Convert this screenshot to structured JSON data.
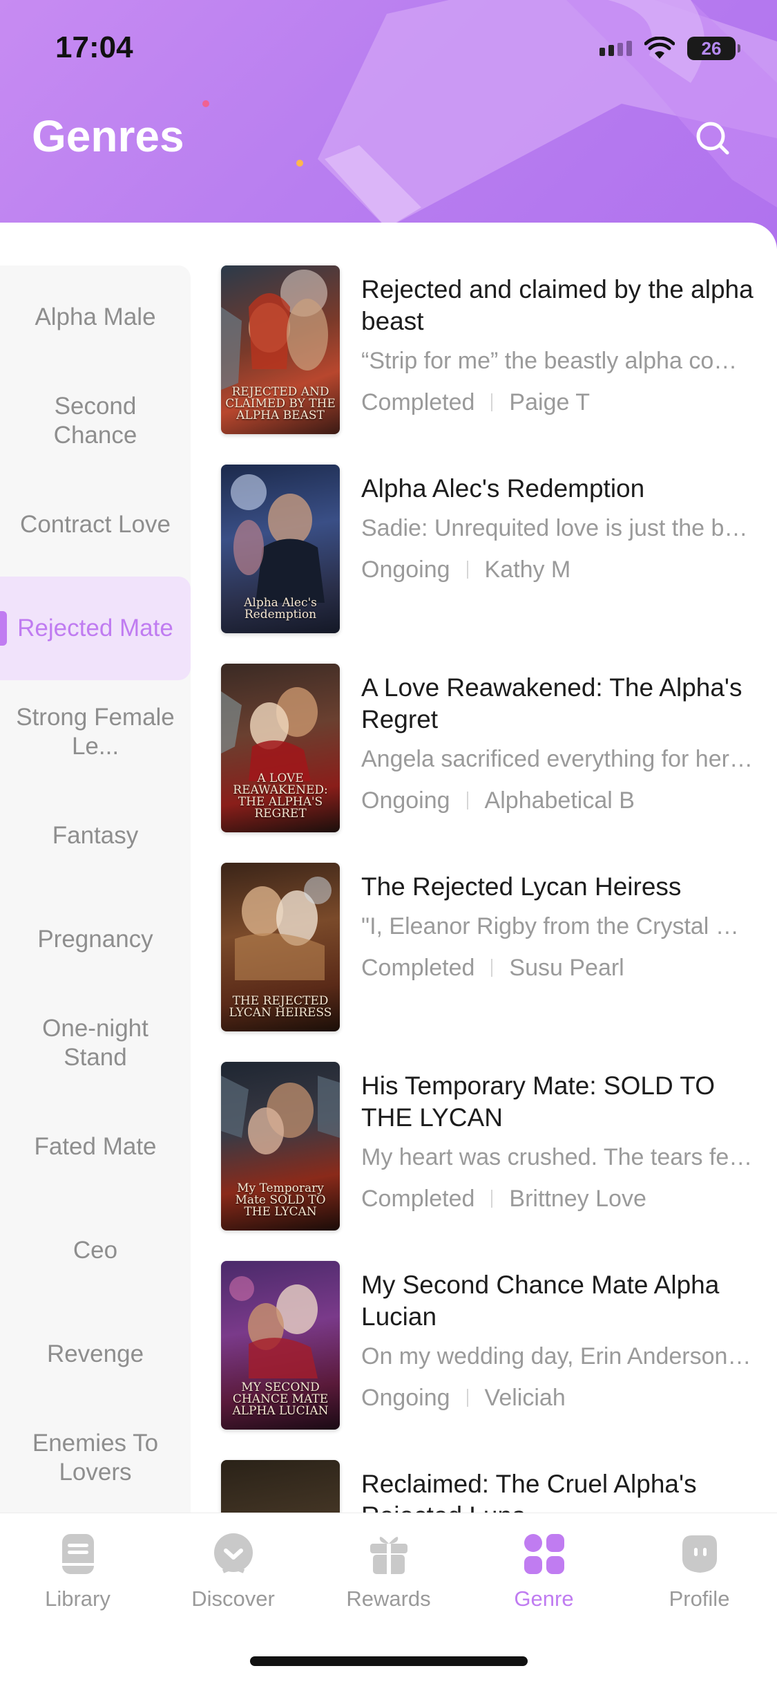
{
  "status": {
    "time": "17:04",
    "battery": "26"
  },
  "header": {
    "title": "Genres"
  },
  "colors": {
    "accent": "#c07cf1",
    "header_bg": "#b97ff0",
    "muted_text": "#9a9a9a"
  },
  "sidebar": {
    "items": [
      {
        "label": "Alpha Male"
      },
      {
        "label": "Second Chance"
      },
      {
        "label": "Contract Love"
      },
      {
        "label": "Rejected Mate",
        "active": true
      },
      {
        "label": "Strong Female Le..."
      },
      {
        "label": "Fantasy"
      },
      {
        "label": "Pregnancy"
      },
      {
        "label": "One-night Stand"
      },
      {
        "label": "Fated Mate"
      },
      {
        "label": "Ceo"
      },
      {
        "label": "Revenge"
      },
      {
        "label": "Enemies To Lovers"
      }
    ]
  },
  "books": [
    {
      "title": "Rejected and claimed by the alpha beast",
      "description": "“Strip for me” the beastly alpha commanded",
      "status": "Completed",
      "author": "Paige T",
      "cover_text": "REJECTED AND CLAIMED BY THE ALPHA BEAST"
    },
    {
      "title": "Alpha Alec's Redemption",
      "description": "Sadie: Unrequited love is just the beginning",
      "status": "Ongoing",
      "author": "Kathy M",
      "cover_text": "Alpha Alec's Redemption"
    },
    {
      "title": "A Love Reawakened: The Alpha's Regret",
      "description": "Angela sacrificed everything for her mate",
      "status": "Ongoing",
      "author": "Alphabetical B",
      "cover_text": "A LOVE REAWAKENED: THE ALPHA'S REGRET"
    },
    {
      "title": "The Rejected Lycan Heiress",
      "description": "\"I, Eleanor Rigby from the Crystal Moon pack",
      "status": "Completed",
      "author": "Susu Pearl",
      "cover_text": "THE REJECTED LYCAN HEIRESS"
    },
    {
      "title": "His Temporary Mate: SOLD TO THE LYCAN",
      "description": "My heart was crushed. The tears fell down",
      "status": "Completed",
      "author": "Brittney Love",
      "cover_text": "My Temporary Mate SOLD TO THE LYCAN"
    },
    {
      "title": "My Second Chance Mate Alpha Lucian",
      "description": "On my wedding day, Erin Anderson was gone",
      "status": "Ongoing",
      "author": "Veliciah",
      "cover_text": "MY SECOND CHANCE MATE ALPHA LUCIAN"
    },
    {
      "title": "Reclaimed: The Cruel Alpha's Rejected Luna",
      "description": "",
      "status": "",
      "author": "",
      "cover_text": ""
    }
  ],
  "tabs": [
    {
      "label": "Library",
      "icon": "book-icon"
    },
    {
      "label": "Discover",
      "icon": "discover-icon"
    },
    {
      "label": "Rewards",
      "icon": "gift-icon"
    },
    {
      "label": "Genre",
      "icon": "grid-icon",
      "active": true
    },
    {
      "label": "Profile",
      "icon": "profile-icon"
    }
  ]
}
